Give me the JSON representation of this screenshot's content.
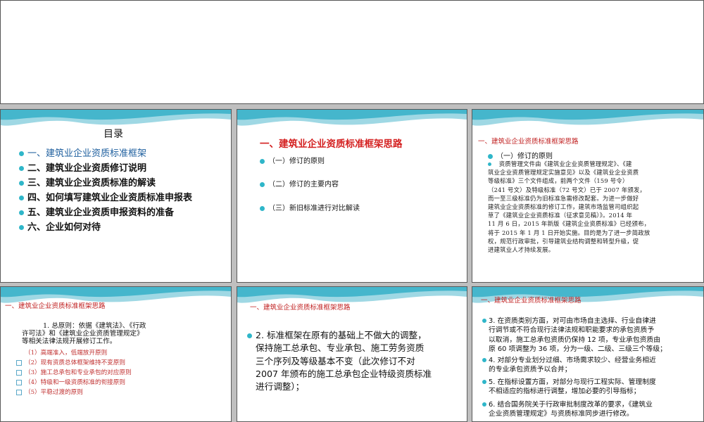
{
  "slides": {
    "s1": {
      "title": "目录",
      "items": [
        "一、建筑业企业资质标准框架",
        "二、建筑业企业资质修订说明",
        "三、建筑业企业资质标准的解读",
        "四、如何填写建筑业企业资质标准申报表",
        "五、建筑业企业资质申报资料的准备",
        "六、企业如何对待"
      ]
    },
    "s2": {
      "title": "一、建筑业企业资质标准框架思路",
      "items": [
        "（一）修订的原则",
        "（二）修订的主要内容",
        "（三）新旧标准进行对比解读"
      ]
    },
    "s3": {
      "header": "一、建筑业企业资质标准框架思路",
      "subheading": "（一）修订的原则",
      "lines": [
        "资质管理文件由《建筑业企业资质管理规定》、《建",
        "筑业企业资质管理规定实施意见》以及《建筑业企业资质",
        "等级标准》三个文件组成，前两个文件（159 号令）",
        "（241 号文）及特级标准（72 号文）已于 2007 年颁发，",
        "而一至三级标准仍为旧标准急需修改配套。为进一步做好",
        "建筑业企业资质标准的修订工作，建筑市场监管司组织起",
        "草了《建筑业企业资质标准（征求意见稿）》。2014 年",
        "11 月 6 日，2015 年新版《建筑企业资质标准》已经颁布，",
        "将于 2015 年 1 月 1 日开始实施。目的是为了进一步简政放",
        "权，规范行政审批，引导建筑业结构调整和转型升级，促",
        "进建筑业人才持续发展。"
      ]
    },
    "s4": {
      "header": "一、建筑业企业资质标准框架思路",
      "intro": [
        "1. 总原则：依据《建筑法》、《行政",
        "许可法》和《建筑业企业资质管理规定》",
        "等相关法律法规开展修订工作。"
      ],
      "items": [
        "（1）高端准入，低端放开原则",
        "（2）现有资质总体框架维持不变原则",
        "（3）施工总承包和专业承包的对应原则",
        "（4）特级和一级资质标准的衔接原则",
        "（5）平稳过渡的原则"
      ]
    },
    "s5": {
      "header": "一、建筑业企业资质标准框架思路",
      "lines": [
        "2. 标准框架在原有的基础上不做大的调整，",
        "保持施工总承包、专业承包、施工劳务资质",
        "三个序列及等级基本不变（此次修订不对",
        "2007 年颁布的施工总承包企业特级资质标准",
        "进行调整）；"
      ]
    },
    "s6": {
      "header": "一、建筑业企业资质标准框架思路",
      "blocks": [
        [
          "3. 在资质类别方面，对可由市场自主选择、行业自律进",
          "行调节或不符合现行法律法规和职能要求的承包资质予",
          "以取消，施工总承包资质仍保持 12 项，专业承包资质由",
          "原 60 项调整为 36 项，分为一级、二级、三级三个等级；"
        ],
        [
          "4. 对部分专业划分过细、市场需求较少、经营业务相近",
          "的专业承包资质予以合并；"
        ],
        [
          "5. 在指标设置方面，对部分与现行工程实际、管理制度",
          "不相适应的指标进行调整，增加必要的引导指标；"
        ],
        [
          "6. 结合国务院关于行政审批制度改革的要求，《建筑业",
          "企业资质管理规定》与资质标准同步进行修改。"
        ]
      ]
    }
  }
}
